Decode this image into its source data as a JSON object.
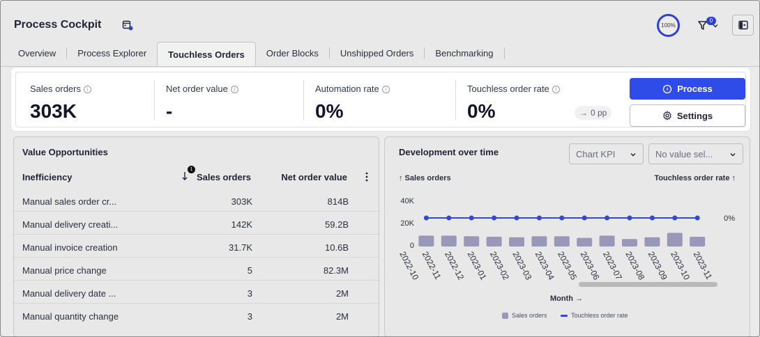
{
  "header": {
    "title": "Process Cockpit",
    "zoom": "100%",
    "filter_count": "0"
  },
  "tabs": [
    {
      "label": "Overview",
      "active": false
    },
    {
      "label": "Process Explorer",
      "active": false
    },
    {
      "label": "Touchless Orders",
      "active": true
    },
    {
      "label": "Order Blocks",
      "active": false
    },
    {
      "label": "Unshipped Orders",
      "active": false
    },
    {
      "label": "Benchmarking",
      "active": false
    }
  ],
  "kpis": [
    {
      "label": "Sales orders",
      "value": "303K"
    },
    {
      "label": "Net order value",
      "value": "-"
    },
    {
      "label": "Automation rate",
      "value": "0%"
    },
    {
      "label": "Touchless order rate",
      "value": "0%",
      "delta": "0 pp"
    }
  ],
  "actions": {
    "process_label": "Process",
    "settings_label": "Settings"
  },
  "value_opportunities": {
    "title": "Value Opportunities",
    "columns": [
      "Inefficiency",
      "Sales orders",
      "Net order value"
    ],
    "sort_badge": "1",
    "rows": [
      {
        "inefficiency": "Manual sales order cr...",
        "sales_orders": "303K",
        "net_order_value": "814B"
      },
      {
        "inefficiency": "Manual delivery creati...",
        "sales_orders": "142K",
        "net_order_value": "59.2B"
      },
      {
        "inefficiency": "Manual invoice creation",
        "sales_orders": "31.7K",
        "net_order_value": "10.6B"
      },
      {
        "inefficiency": "Manual price change",
        "sales_orders": "5",
        "net_order_value": "82.3M"
      },
      {
        "inefficiency": "Manual delivery date ...",
        "sales_orders": "3",
        "net_order_value": "2M"
      },
      {
        "inefficiency": "Manual quantity change",
        "sales_orders": "3",
        "net_order_value": "2M"
      }
    ]
  },
  "development": {
    "title": "Development over time",
    "select_kpi": "Chart KPI",
    "select_value": "No value sel...",
    "left_axis_label": "↑ Sales orders",
    "right_axis_label": "Touchless order rate ↑",
    "x_axis_label": "Month →",
    "right_tick": "0%",
    "legend": [
      "Sales orders",
      "Touchless order rate"
    ],
    "colors": {
      "bar": "#9a98b8",
      "line": "#3347d6"
    }
  },
  "chart_data": {
    "type": "bar",
    "categories": [
      "2022-10",
      "2022-11",
      "2022-12",
      "2023-01",
      "2023-02",
      "2023-03",
      "2023-04",
      "2023-05",
      "2023-06",
      "2023-07",
      "2023-08",
      "2023-09",
      "2023-10",
      "2023-11"
    ],
    "series": [
      {
        "name": "Sales orders",
        "type": "bar",
        "values": [
          null,
          8500,
          8500,
          8000,
          7500,
          7000,
          8000,
          8000,
          6500,
          8500,
          5500,
          7000,
          11000,
          7500
        ]
      },
      {
        "name": "Touchless order rate",
        "type": "line",
        "values": [
          null,
          0,
          0,
          0,
          0,
          0,
          0,
          0,
          0,
          0,
          0,
          0,
          0,
          0
        ]
      }
    ],
    "yticks": [
      "0",
      "20K",
      "40K"
    ],
    "ylim": [
      0,
      40000
    ],
    "xlabel": "Month →",
    "ylabel": "↑ Sales orders",
    "y2label": "Touchless order rate ↑",
    "legend_position": "bottom"
  }
}
